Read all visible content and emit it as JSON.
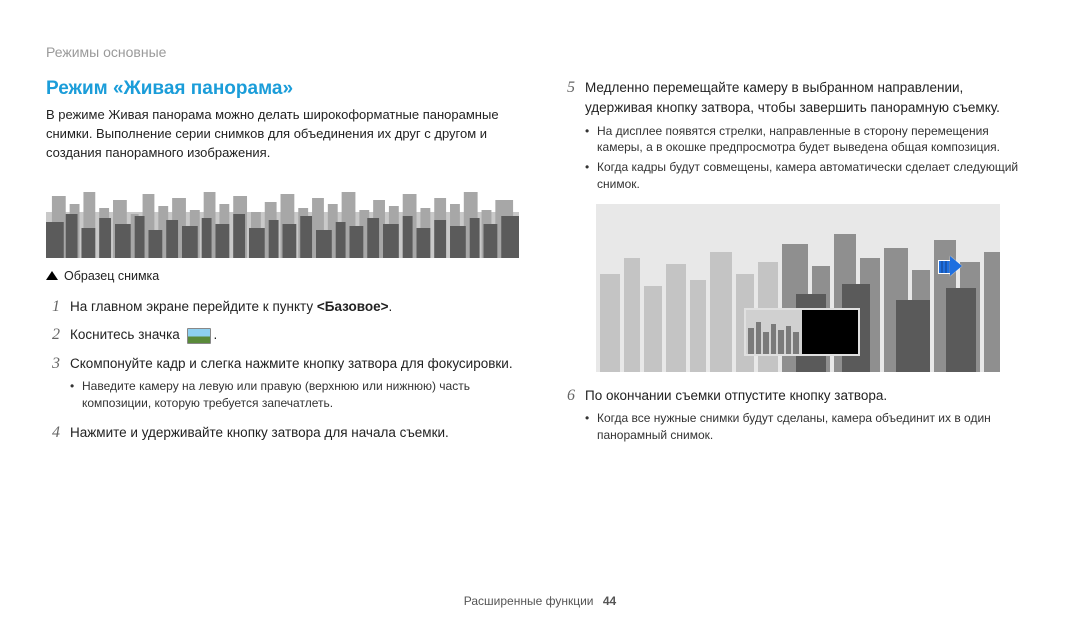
{
  "header": {
    "breadcrumb": "Режимы основные"
  },
  "section": {
    "title": "Режим «Живая панорама»",
    "intro": "В режиме Живая панорама можно делать широкоформатные панорамные снимки. Выполнение серии снимков для объединения их друг с другом и создания панорамного изображения.",
    "caption": "Образец снимка"
  },
  "steps_left": [
    {
      "num": "1",
      "pre": "На главном экране перейдите к пункту ",
      "bold": "<Базовое>",
      "post": "."
    },
    {
      "num": "2",
      "pre": "Коснитесь значка ",
      "icon": true,
      "post": "."
    },
    {
      "num": "3",
      "pre": "Скомпонуйте кадр и слегка нажмите кнопку затвора для фокусировки.",
      "sub": [
        "Наведите камеру на левую или правую (верхнюю или нижнюю) часть композиции, которую требуется запечатлеть."
      ]
    },
    {
      "num": "4",
      "pre": "Нажмите и удерживайте кнопку затвора для начала съемки."
    }
  ],
  "steps_right": [
    {
      "num": "5",
      "pre": "Медленно перемещайте камеру в выбранном направлении, удерживая кнопку затвора, чтобы завершить панорамную съемку.",
      "sub": [
        "На дисплее появятся стрелки, направленные в сторону перемещения камеры, а в окошке предпросмотра будет выведена общая композиция.",
        "Когда кадры будут совмещены, камера автоматически сделает следующий снимок."
      ]
    },
    {
      "num": "6",
      "pre": "По окончании съемки отпустите кнопку затвора.",
      "sub": [
        "Когда все нужные снимки будут сделаны, камера объединит их в один панорамный снимок."
      ]
    }
  ],
  "footer": {
    "label": "Расширенные функции",
    "page": "44"
  }
}
